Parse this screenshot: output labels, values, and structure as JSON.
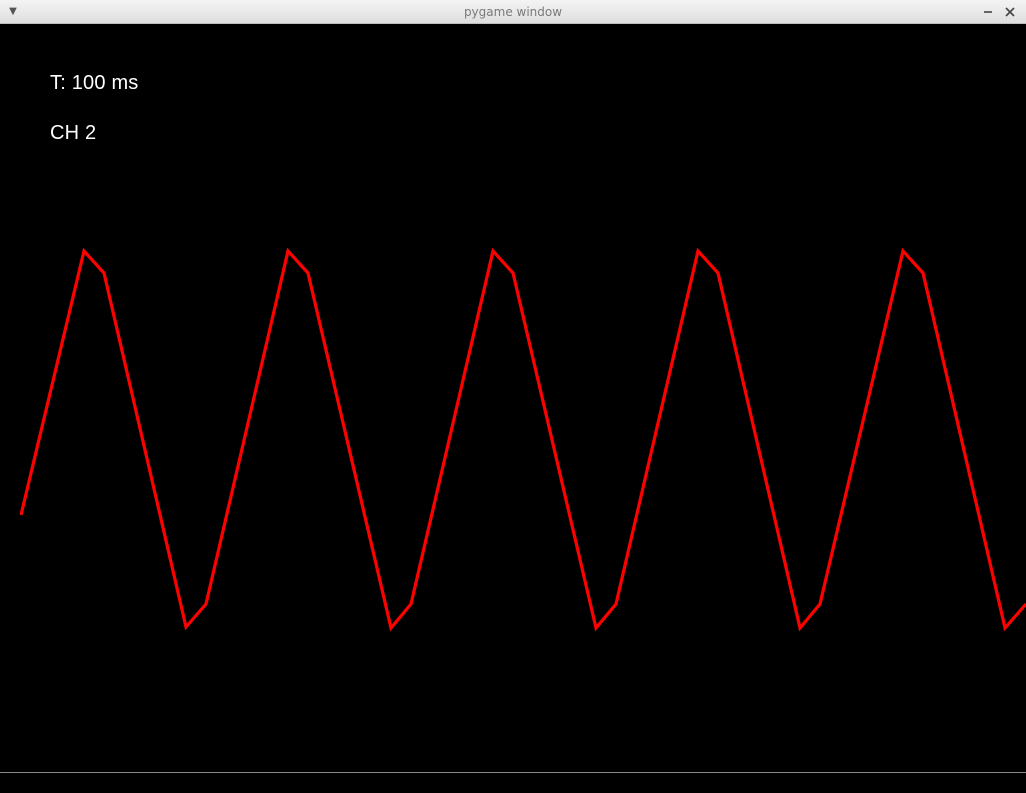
{
  "window": {
    "title": "pygame window",
    "menu_icon": "chevron-down-icon",
    "minimize_glyph": "—",
    "close_glyph": "✕"
  },
  "hud": {
    "timebase": "T: 100 ms",
    "channel": "CH 2"
  },
  "waveform": {
    "color": "#ff0000",
    "background": "#000000"
  }
}
